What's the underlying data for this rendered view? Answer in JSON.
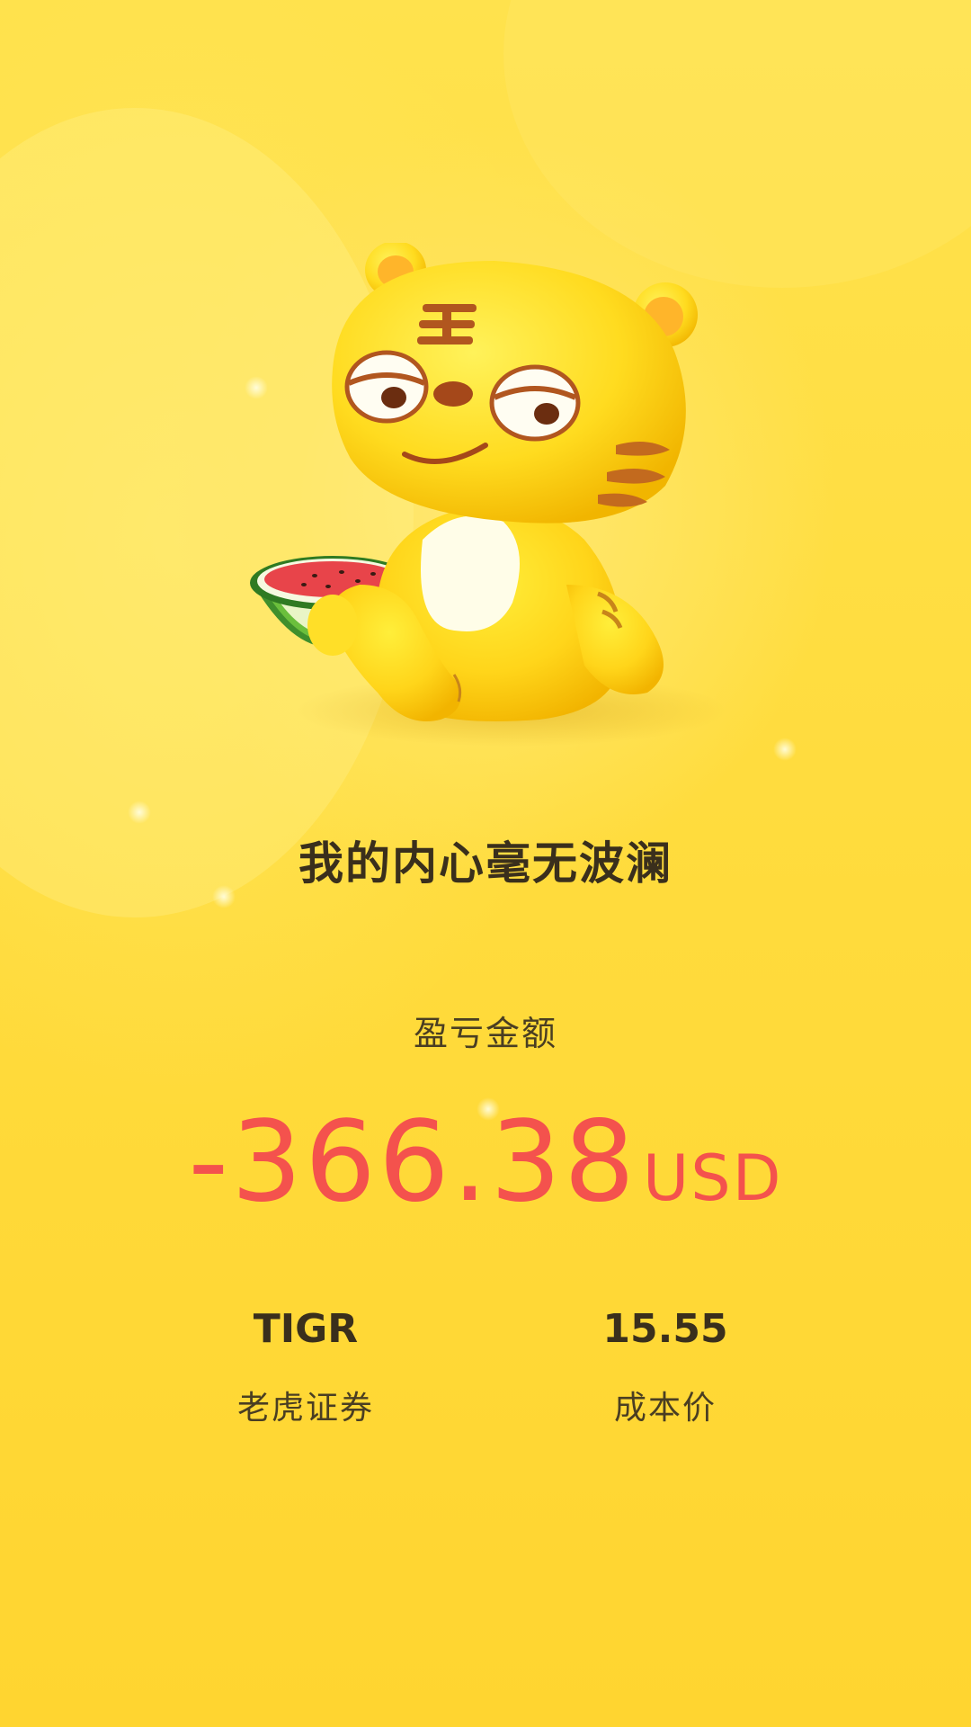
{
  "headline": "我的内心毫无波澜",
  "pnl": {
    "label": "盈亏金额",
    "amount": "-366.38",
    "currency": "USD"
  },
  "stock": {
    "ticker": "TIGR",
    "name": "老虎证券"
  },
  "cost": {
    "value": "15.55",
    "label": "成本价"
  },
  "illustration": {
    "icon": "tiger-mascot-with-watermelon-icon"
  },
  "colors": {
    "background": "#ffd93a",
    "loss": "#f4524d",
    "text": "#3a2f1c"
  }
}
